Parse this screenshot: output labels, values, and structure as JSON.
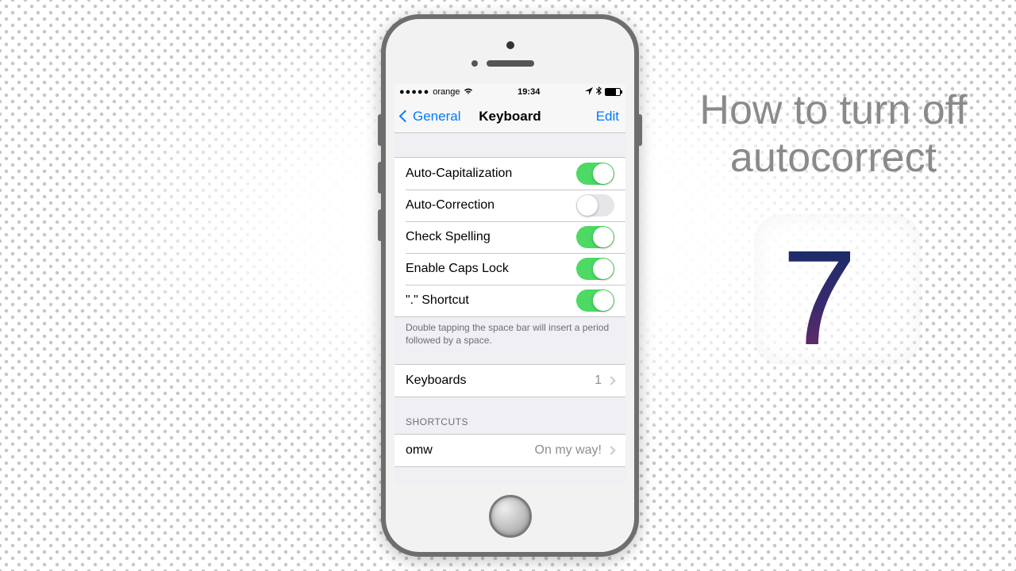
{
  "headline": {
    "line1": "How to turn off",
    "line2": "autocorrect",
    "version_glyph": "7"
  },
  "status": {
    "carrier": "orange",
    "time": "19:34",
    "signal_dots": "●●●●●"
  },
  "nav": {
    "back_label": "General",
    "title": "Keyboard",
    "edit_label": "Edit"
  },
  "toggles": [
    {
      "label": "Auto-Capitalization",
      "on": true
    },
    {
      "label": "Auto-Correction",
      "on": false
    },
    {
      "label": "Check Spelling",
      "on": true
    },
    {
      "label": "Enable Caps Lock",
      "on": true
    },
    {
      "label": "\".\" Shortcut",
      "on": true
    }
  ],
  "footer_note": "Double tapping the space bar will insert a period followed by a space.",
  "keyboards_row": {
    "label": "Keyboards",
    "count": "1"
  },
  "shortcuts": {
    "header": "SHORTCUTS",
    "items": [
      {
        "key": "omw",
        "phrase": "On my way!"
      }
    ]
  }
}
